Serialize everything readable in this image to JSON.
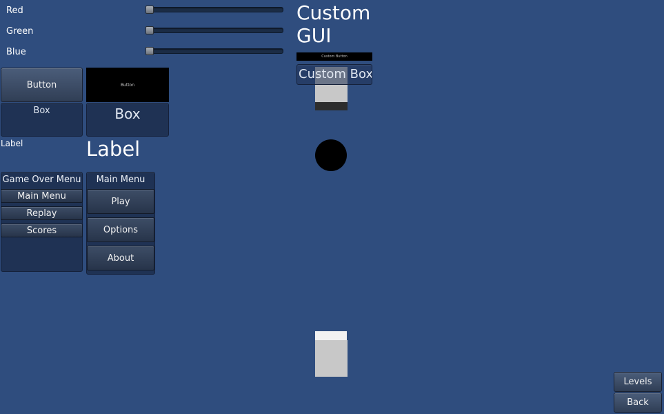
{
  "sliders": [
    {
      "label": "Red",
      "value": 0
    },
    {
      "label": "Green",
      "value": 0
    },
    {
      "label": "Blue",
      "value": 0
    }
  ],
  "default_widgets": {
    "button_label": "Button",
    "box_label": "Box",
    "label_text": "Label"
  },
  "styled_widgets": {
    "button_label": "Button",
    "box_label": "Box",
    "label_text": "Label"
  },
  "custom_gui": {
    "title": "Custom GUI",
    "button_label": "Custom Button",
    "box_label": "Custom Box"
  },
  "game_over_menu": {
    "title": "Game Over Menu",
    "items": [
      "Main Menu",
      "Replay",
      "Scores"
    ]
  },
  "main_menu": {
    "title": "Main Menu",
    "items": [
      "Play",
      "Options",
      "About"
    ]
  },
  "nav": {
    "levels_label": "Levels",
    "back_label": "Back"
  },
  "colors": {
    "background": "#2f4d7e",
    "custom_button_bg": "#000000",
    "sphere": "#000000"
  }
}
